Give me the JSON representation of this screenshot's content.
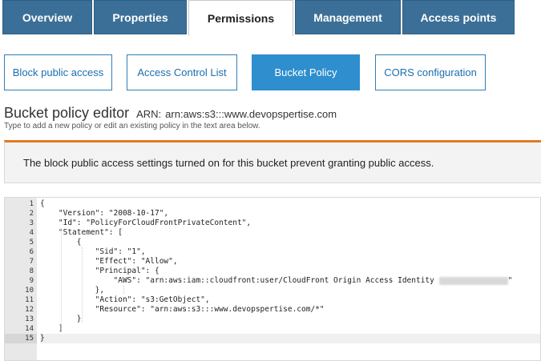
{
  "tabs": [
    {
      "label": "Overview",
      "active": false
    },
    {
      "label": "Properties",
      "active": false
    },
    {
      "label": "Permissions",
      "active": true
    },
    {
      "label": "Management",
      "active": false
    },
    {
      "label": "Access points",
      "active": false
    }
  ],
  "subtabs": [
    {
      "label": "Block public access",
      "active": false
    },
    {
      "label": "Access Control List",
      "active": false
    },
    {
      "label": "Bucket Policy",
      "active": true
    },
    {
      "label": "CORS configuration",
      "active": false
    }
  ],
  "header": {
    "title": "Bucket policy editor",
    "arn_label": "ARN:",
    "arn_value": "arn:aws:s3:::www.devopspertise.com",
    "subtitle": "Type to add a new policy or edit an existing policy in the text area below."
  },
  "warning": {
    "text": "The block public access settings turned on for this bucket prevent granting public access."
  },
  "editor": {
    "current_line": 15,
    "lines": [
      "{",
      "    \"Version\": \"2008-10-17\",",
      "    \"Id\": \"PolicyForCloudFrontPrivateContent\",",
      "    \"Statement\": [",
      "        {",
      "            \"Sid\": \"1\",",
      "            \"Effect\": \"Allow\",",
      "            \"Principal\": {",
      "                \"AWS\": \"arn:aws:iam::cloudfront:user/CloudFront Origin Access Identity ",
      "            },",
      "            \"Action\": \"s3:GetObject\",",
      "            \"Resource\": \"arn:aws:s3:::www.devopspertise.com/*\"",
      "        }",
      "    ]",
      "}"
    ],
    "line9_suffix": "\""
  }
}
